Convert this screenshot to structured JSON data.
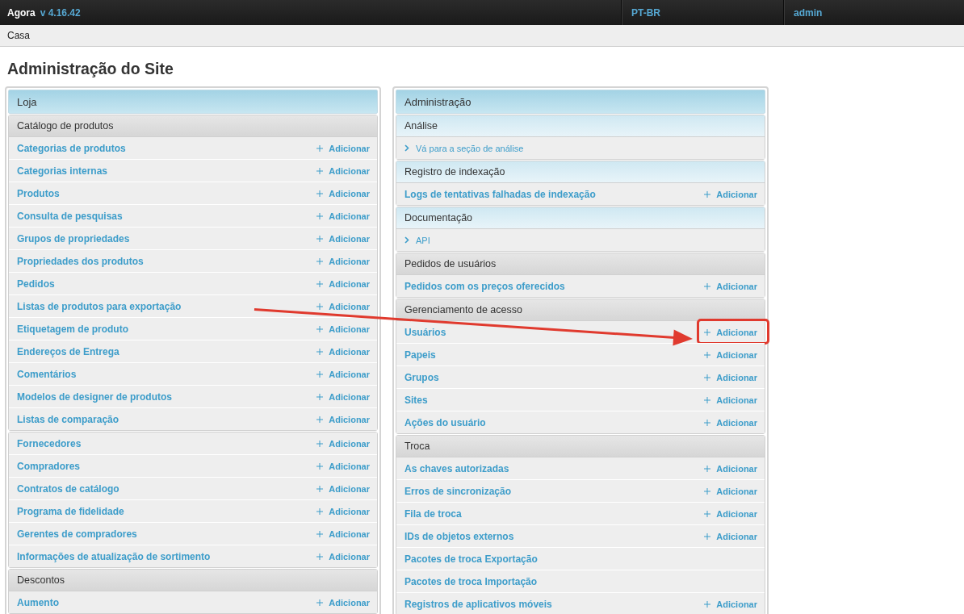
{
  "header": {
    "brand": "Agora",
    "version": "v 4.16.42",
    "menu": [
      {
        "label": "PT-BR"
      },
      {
        "label": "admin"
      }
    ]
  },
  "breadcrumb": "Casa",
  "title": "Administração do Site",
  "modules": [
    {
      "title": "Loja",
      "groups": [
        {
          "caption": "Catálogo de produtos",
          "kind": "category",
          "rows": [
            {
              "kind": "model",
              "label": "Categorias de produtos",
              "add": "Adicionar",
              "highlighted": false
            },
            {
              "kind": "model",
              "label": "Categorias internas",
              "add": "Adicionar",
              "highlighted": false
            },
            {
              "kind": "model",
              "label": "Produtos",
              "add": "Adicionar",
              "highlighted": false
            },
            {
              "kind": "model",
              "label": "Consulta de pesquisas",
              "add": "Adicionar",
              "highlighted": false
            },
            {
              "kind": "model",
              "label": "Grupos de propriedades",
              "add": "Adicionar",
              "highlighted": false
            },
            {
              "kind": "model",
              "label": "Propriedades dos produtos",
              "add": "Adicionar",
              "highlighted": false
            },
            {
              "kind": "model",
              "label": "Pedidos",
              "add": "Adicionar",
              "highlighted": false
            },
            {
              "kind": "model",
              "label": "Listas de produtos para exportação",
              "add": "Adicionar",
              "highlighted": false
            },
            {
              "kind": "model",
              "label": "Etiquetagem de produto",
              "add": "Adicionar",
              "highlighted": false
            },
            {
              "kind": "model",
              "label": "Endereços de Entrega",
              "add": "Adicionar",
              "highlighted": false
            },
            {
              "kind": "model",
              "label": "Comentários",
              "add": "Adicionar",
              "highlighted": false
            },
            {
              "kind": "model",
              "label": "Modelos de designer de produtos",
              "add": "Adicionar",
              "highlighted": false
            },
            {
              "kind": "model",
              "label": "Listas de comparação",
              "add": "Adicionar",
              "highlighted": false
            }
          ]
        },
        {
          "rows": [
            {
              "kind": "model",
              "label": "Fornecedores",
              "add": "Adicionar",
              "highlighted": false
            },
            {
              "kind": "model",
              "label": "Compradores",
              "add": "Adicionar",
              "highlighted": false
            },
            {
              "kind": "model",
              "label": "Contratos de catálogo",
              "add": "Adicionar",
              "highlighted": false
            },
            {
              "kind": "model",
              "label": "Programa de fidelidade",
              "add": "Adicionar",
              "highlighted": false
            },
            {
              "kind": "model",
              "label": "Gerentes de compradores",
              "add": "Adicionar",
              "highlighted": false
            },
            {
              "kind": "model",
              "label": "Informações de atualização de sortimento",
              "add": "Adicionar",
              "highlighted": false
            }
          ]
        },
        {
          "caption": "Descontos",
          "kind": "category",
          "rows": [
            {
              "kind": "model",
              "label": "Aumento",
              "add": "Adicionar",
              "highlighted": false
            }
          ]
        }
      ]
    },
    {
      "title": "Administração",
      "groups": [
        {
          "caption": "Análise",
          "kind": "section",
          "rows": [
            {
              "kind": "link",
              "label": "Vá para a seção de análise",
              "highlighted": false
            }
          ]
        },
        {
          "caption": "Registro de indexação",
          "kind": "section",
          "rows": [
            {
              "kind": "model",
              "label": "Logs de tentativas falhadas de indexação",
              "add": "Adicionar",
              "highlighted": false
            }
          ]
        },
        {
          "caption": "Documentação",
          "kind": "section",
          "rows": [
            {
              "kind": "link",
              "label": "API",
              "highlighted": false
            }
          ]
        },
        {
          "caption": "Pedidos de usuários",
          "kind": "category",
          "rows": [
            {
              "kind": "model",
              "label": "Pedidos com os preços oferecidos",
              "add": "Adicionar",
              "highlighted": false
            }
          ]
        },
        {
          "caption": "Gerenciamento de acesso",
          "kind": "category",
          "rows": [
            {
              "kind": "model",
              "label": "Usuários",
              "add": "Adicionar",
              "highlighted": true
            },
            {
              "kind": "model",
              "label": "Papeis",
              "add": "Adicionar",
              "highlighted": false
            },
            {
              "kind": "model",
              "label": "Grupos",
              "add": "Adicionar",
              "highlighted": false
            },
            {
              "kind": "model",
              "label": "Sites",
              "add": "Adicionar",
              "highlighted": false
            },
            {
              "kind": "model",
              "label": "Ações do usuário",
              "add": "Adicionar",
              "highlighted": false
            }
          ]
        },
        {
          "caption": "Troca",
          "kind": "category",
          "rows": [
            {
              "kind": "model",
              "label": "As chaves autorizadas",
              "add": "Adicionar",
              "highlighted": false
            },
            {
              "kind": "model",
              "label": "Erros de sincronização",
              "add": "Adicionar",
              "highlighted": false
            },
            {
              "kind": "model",
              "label": "Fila de troca",
              "add": "Adicionar",
              "highlighted": false
            },
            {
              "kind": "model",
              "label": "IDs de objetos externos",
              "add": "Adicionar",
              "highlighted": false
            },
            {
              "kind": "model",
              "label": "Pacotes de troca Exportação",
              "highlighted": false
            },
            {
              "kind": "model",
              "label": "Pacotes de troca Importação",
              "highlighted": false
            },
            {
              "kind": "model",
              "label": "Registros de aplicativos móveis",
              "add": "Adicionar",
              "highlighted": false
            }
          ]
        }
      ]
    }
  ]
}
